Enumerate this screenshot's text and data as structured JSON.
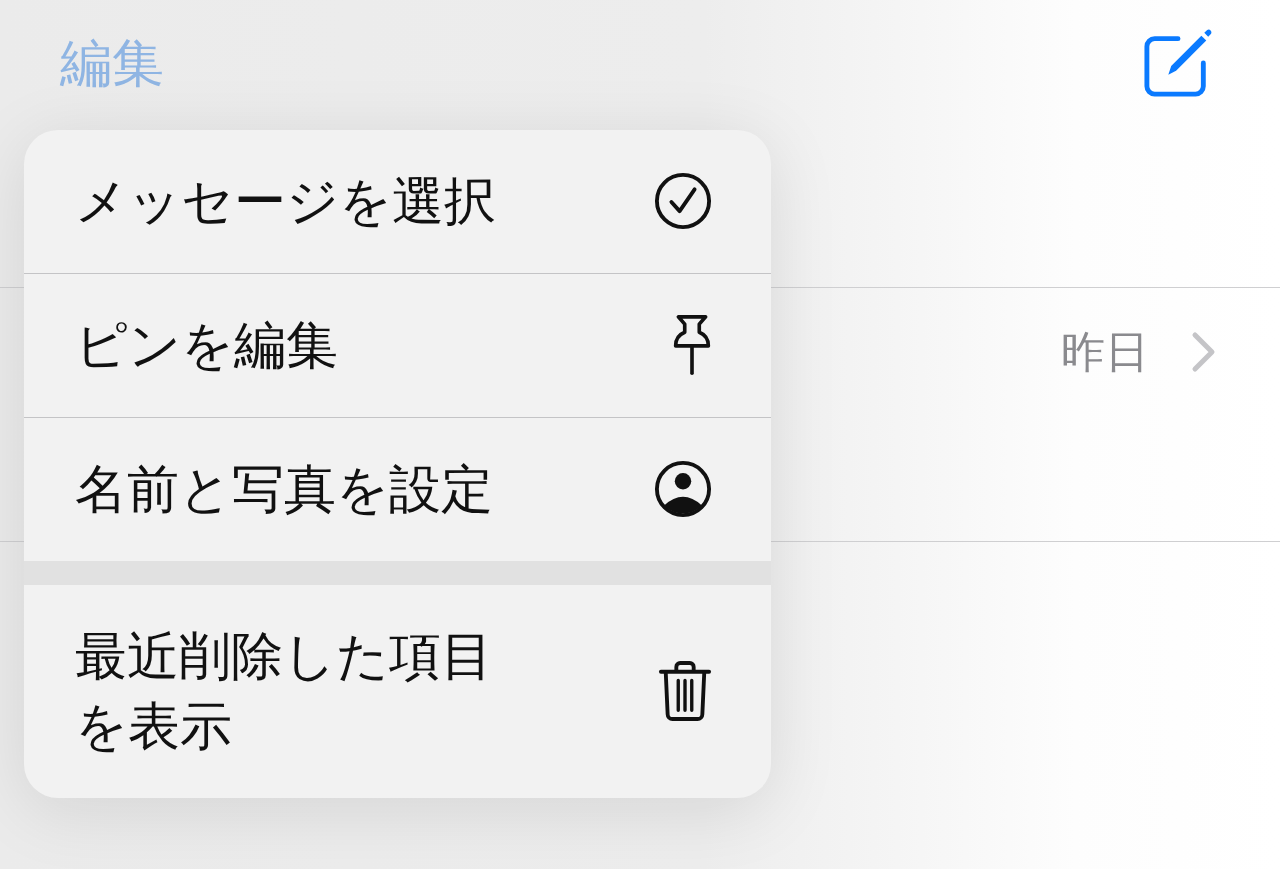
{
  "nav_bar": {
    "edit_label": "編集"
  },
  "conversations": [
    {
      "date": "昨日"
    }
  ],
  "context_menu": {
    "sections": [
      {
        "items": [
          {
            "label": "メッセージを選択",
            "kind": "select"
          },
          {
            "label": "ピンを編集",
            "kind": "pin"
          },
          {
            "label": "名前と写真を設定",
            "kind": "profile"
          }
        ]
      },
      {
        "items": [
          {
            "label": "最近削除した項目を表示",
            "kind": "trash"
          }
        ]
      }
    ]
  }
}
